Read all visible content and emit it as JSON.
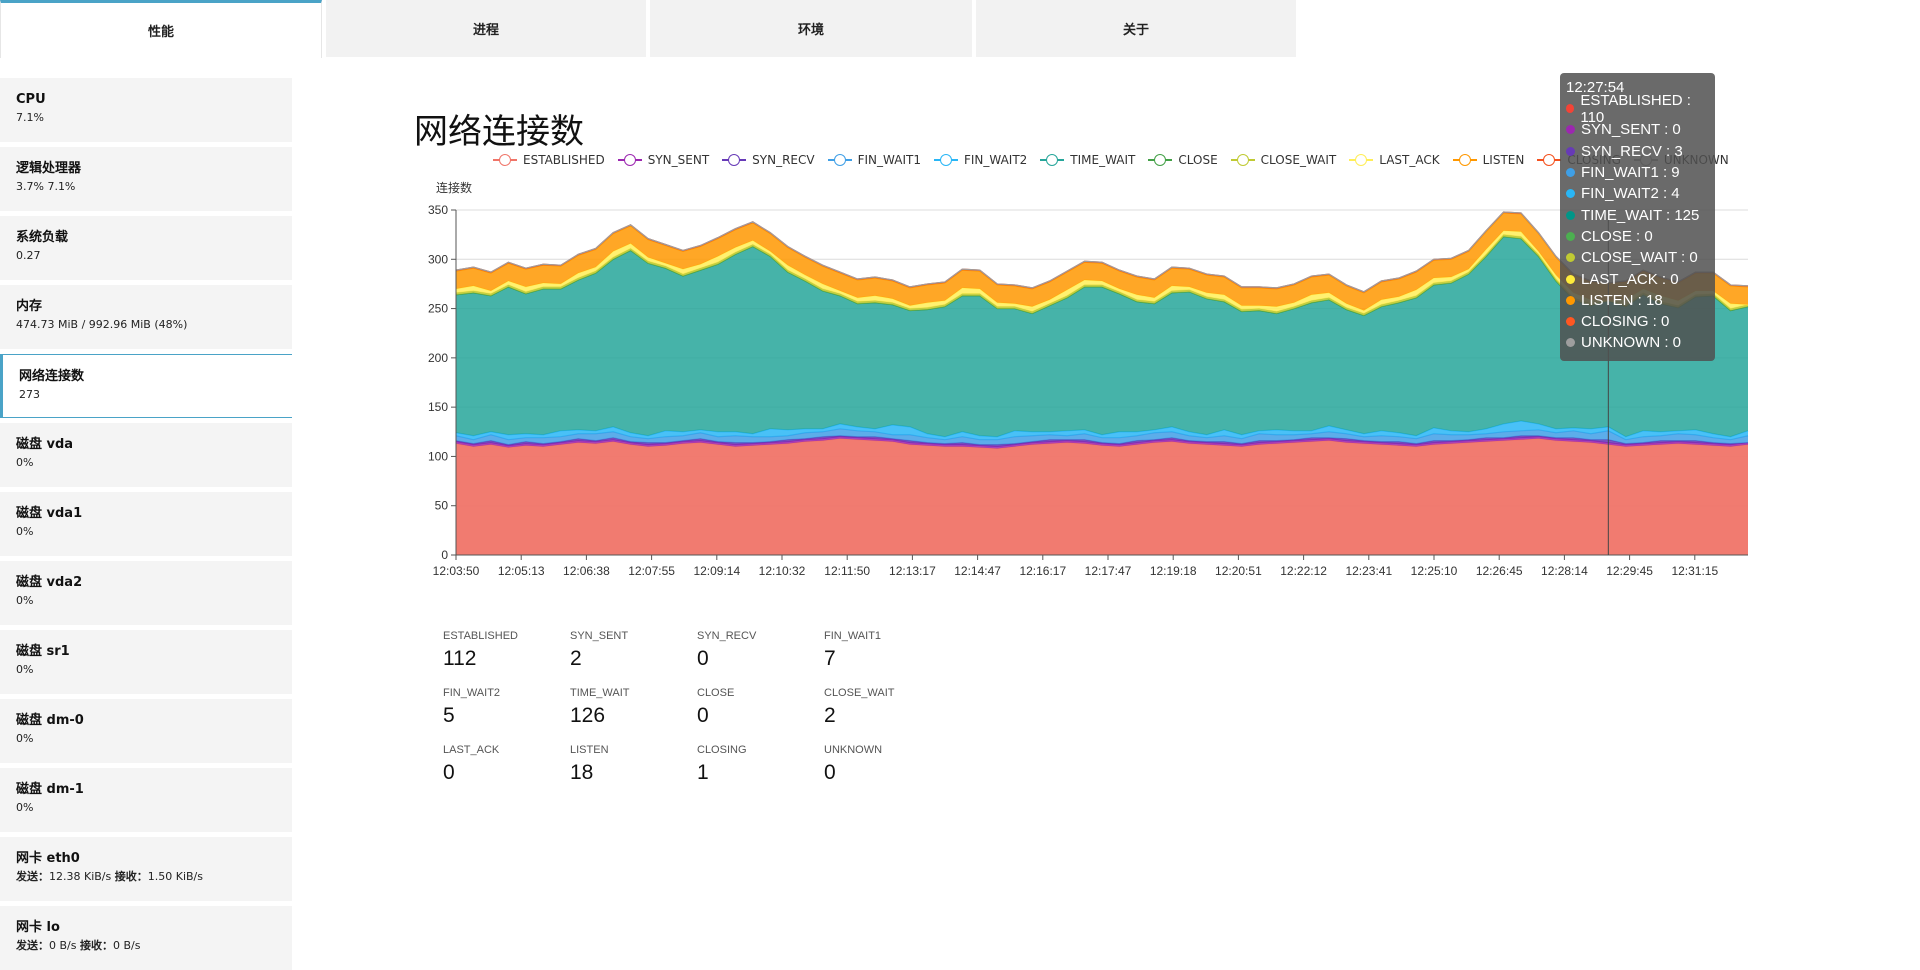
{
  "tabs": [
    {
      "label": "性能",
      "active": true
    },
    {
      "label": "进程",
      "active": false
    },
    {
      "label": "环境",
      "active": false
    },
    {
      "label": "关于",
      "active": false
    }
  ],
  "sidebar": {
    "items": [
      {
        "title": "CPU",
        "value": "7.1%"
      },
      {
        "title": "逻辑处理器",
        "value": "3.7% 7.1%"
      },
      {
        "title": "系统负载",
        "value": "0.27"
      },
      {
        "title": "内存",
        "value": "474.73 MiB / 992.96 MiB (48%)"
      },
      {
        "title": "网络连接数",
        "value": "273",
        "active": true
      },
      {
        "title": "磁盘 vda",
        "value": "0%"
      },
      {
        "title": "磁盘 vda1",
        "value": "0%"
      },
      {
        "title": "磁盘 vda2",
        "value": "0%"
      },
      {
        "title": "磁盘 sr1",
        "value": "0%"
      },
      {
        "title": "磁盘 dm-0",
        "value": "0%"
      },
      {
        "title": "磁盘 dm-1",
        "value": "0%"
      },
      {
        "title": "网卡 eth0",
        "send_label": "发送：",
        "send": "12.38 KiB/s",
        "recv_label": "接收：",
        "recv": "1.50 KiB/s"
      },
      {
        "title": "网卡 lo",
        "send_label": "发送：",
        "send": "0 B/s",
        "recv_label": "接收：",
        "recv": "0 B/s"
      }
    ]
  },
  "main": {
    "title": "网络连接数"
  },
  "chart_data": {
    "type": "area",
    "stacked": true,
    "ylabel": "连接数",
    "ylim": [
      0,
      350
    ],
    "yticks": [
      0,
      50,
      100,
      150,
      200,
      250,
      300,
      350
    ],
    "x_ticks": [
      "12:03:50",
      "12:05:13",
      "12:06:38",
      "12:07:55",
      "12:09:14",
      "12:10:32",
      "12:11:50",
      "12:13:17",
      "12:14:47",
      "12:16:17",
      "12:17:47",
      "12:19:18",
      "12:20:51",
      "12:22:12",
      "12:23:41",
      "12:25:10",
      "12:26:45",
      "12:28:14",
      "12:29:45",
      "12:31:15"
    ],
    "legend_position": "top",
    "series": [
      {
        "name": "ESTABLISHED",
        "color": "#f07468",
        "values": [
          113,
          110,
          112,
          109,
          111,
          110,
          112,
          114,
          113,
          115,
          112,
          110,
          111,
          113,
          114,
          112,
          110,
          111,
          112,
          113,
          115,
          116,
          118,
          117,
          116,
          115,
          112,
          111,
          110,
          110,
          109,
          108,
          110,
          112,
          113,
          114,
          113,
          111,
          110,
          112,
          114,
          115,
          113,
          112,
          111,
          110,
          112,
          113,
          114,
          115,
          116,
          114,
          113,
          112,
          111,
          110,
          112,
          113,
          114,
          115,
          116,
          117,
          118,
          116,
          115,
          114,
          112,
          110,
          111,
          112,
          113,
          112,
          111,
          110,
          112
        ]
      },
      {
        "name": "SYN_SENT",
        "color": "#9c27b0",
        "values": [
          2,
          2,
          2,
          2,
          2,
          2,
          2,
          2,
          2,
          2,
          2,
          2,
          2,
          2,
          2,
          2,
          2,
          2,
          2,
          2,
          2,
          2,
          2,
          2,
          2,
          2,
          2,
          2,
          2,
          2,
          2,
          2,
          2,
          2,
          2,
          2,
          2,
          2,
          2,
          2,
          2,
          2,
          2,
          2,
          2,
          2,
          2,
          2,
          2,
          2,
          2,
          2,
          2,
          2,
          2,
          2,
          2,
          2,
          2,
          2,
          2,
          2,
          2,
          2,
          2,
          2,
          2,
          2,
          2,
          2,
          2,
          2,
          2,
          2,
          2
        ]
      },
      {
        "name": "SYN_RECV",
        "color": "#673ab7",
        "values": [
          1,
          1,
          2,
          1,
          2,
          1,
          1,
          2,
          1,
          2,
          1,
          2,
          1,
          1,
          2,
          1,
          2,
          1,
          1,
          2,
          1,
          2,
          1,
          1,
          2,
          1,
          2,
          1,
          1,
          2,
          1,
          2,
          1,
          1,
          2,
          1,
          2,
          1,
          1,
          2,
          1,
          2,
          1,
          1,
          2,
          1,
          2,
          1,
          1,
          2,
          1,
          2,
          1,
          1,
          2,
          1,
          2,
          1,
          1,
          2,
          1,
          2,
          1,
          1,
          2,
          1,
          3,
          1,
          1,
          2,
          1,
          2,
          1,
          1,
          0
        ]
      },
      {
        "name": "FIN_WAIT1",
        "color": "#3f9fe6",
        "values": [
          5,
          4,
          6,
          5,
          4,
          6,
          5,
          5,
          7,
          6,
          5,
          4,
          6,
          5,
          6,
          5,
          7,
          6,
          5,
          4,
          6,
          5,
          7,
          6,
          5,
          4,
          6,
          5,
          4,
          6,
          5,
          5,
          7,
          6,
          5,
          4,
          6,
          5,
          6,
          5,
          7,
          6,
          5,
          4,
          6,
          5,
          7,
          6,
          5,
          4,
          6,
          5,
          4,
          6,
          5,
          5,
          7,
          6,
          5,
          4,
          6,
          5,
          6,
          5,
          7,
          6,
          9,
          4,
          6,
          5,
          7,
          6,
          5,
          4,
          7
        ]
      },
      {
        "name": "FIN_WAIT2",
        "color": "#29b6f6",
        "values": [
          3,
          4,
          3,
          5,
          4,
          3,
          6,
          4,
          3,
          5,
          4,
          3,
          6,
          4,
          3,
          5,
          4,
          3,
          8,
          6,
          4,
          3,
          5,
          4,
          3,
          10,
          8,
          4,
          3,
          5,
          4,
          3,
          6,
          4,
          3,
          5,
          4,
          3,
          6,
          4,
          3,
          5,
          4,
          3,
          6,
          4,
          3,
          5,
          4,
          3,
          6,
          4,
          3,
          5,
          4,
          3,
          6,
          4,
          3,
          5,
          8,
          10,
          6,
          4,
          3,
          5,
          4,
          3,
          6,
          4,
          3,
          5,
          4,
          3,
          5
        ]
      },
      {
        "name": "TIME_WAIT",
        "color": "#26a69a",
        "values": [
          140,
          145,
          138,
          150,
          142,
          148,
          144,
          152,
          160,
          170,
          185,
          175,
          165,
          158,
          162,
          170,
          180,
          190,
          175,
          160,
          150,
          140,
          130,
          125,
          128,
          122,
          118,
          126,
          132,
          138,
          142,
          130,
          124,
          120,
          128,
          135,
          145,
          150,
          140,
          132,
          128,
          136,
          142,
          138,
          130,
          125,
          122,
          118,
          124,
          130,
          128,
          122,
          120,
          126,
          132,
          140,
          145,
          150,
          160,
          175,
          190,
          185,
          170,
          150,
          130,
          125,
          128,
          132,
          138,
          130,
          125,
          135,
          140,
          128,
          126
        ]
      },
      {
        "name": "CLOSE",
        "color": "#43a047",
        "values": [
          0,
          0,
          0,
          0,
          0,
          0,
          0,
          0,
          0,
          0,
          0,
          0,
          0,
          0,
          0,
          0,
          0,
          0,
          0,
          0,
          0,
          0,
          0,
          0,
          0,
          0,
          0,
          0,
          0,
          0,
          0,
          0,
          0,
          0,
          0,
          0,
          0,
          0,
          0,
          0,
          0,
          0,
          0,
          0,
          0,
          0,
          0,
          0,
          0,
          0,
          0,
          0,
          0,
          0,
          0,
          0,
          0,
          0,
          0,
          0,
          0,
          0,
          0,
          0,
          0,
          0,
          0,
          0,
          0,
          0,
          0,
          0,
          0,
          0,
          0
        ]
      },
      {
        "name": "CLOSE_WAIT",
        "color": "#c0ca33",
        "values": [
          2,
          2,
          2,
          2,
          2,
          2,
          2,
          2,
          2,
          2,
          2,
          2,
          2,
          2,
          2,
          2,
          2,
          2,
          2,
          2,
          2,
          2,
          2,
          2,
          2,
          2,
          2,
          2,
          2,
          2,
          2,
          2,
          2,
          2,
          2,
          2,
          2,
          2,
          2,
          2,
          2,
          2,
          2,
          2,
          2,
          2,
          2,
          2,
          2,
          2,
          2,
          2,
          2,
          2,
          2,
          2,
          2,
          2,
          2,
          2,
          2,
          2,
          2,
          2,
          2,
          2,
          0,
          2,
          2,
          2,
          2,
          2,
          2,
          2,
          2
        ]
      },
      {
        "name": "LAST_ACK",
        "color": "#ffee58",
        "values": [
          4,
          5,
          3,
          4,
          5,
          4,
          3,
          5,
          4,
          6,
          5,
          4,
          3,
          5,
          4,
          6,
          5,
          4,
          3,
          5,
          4,
          5,
          3,
          4,
          5,
          4,
          3,
          5,
          4,
          6,
          5,
          4,
          3,
          5,
          4,
          6,
          5,
          4,
          3,
          5,
          4,
          5,
          3,
          4,
          5,
          4,
          3,
          5,
          4,
          6,
          5,
          4,
          3,
          5,
          4,
          6,
          5,
          4,
          3,
          5,
          4,
          5,
          3,
          4,
          5,
          4,
          0,
          5,
          4,
          6,
          5,
          4,
          3,
          5,
          0
        ]
      },
      {
        "name": "LISTEN",
        "color": "#ff9800",
        "values": [
          18,
          18,
          18,
          18,
          18,
          18,
          18,
          18,
          18,
          18,
          18,
          18,
          18,
          18,
          18,
          18,
          18,
          18,
          18,
          18,
          18,
          18,
          18,
          18,
          18,
          18,
          18,
          18,
          18,
          18,
          18,
          18,
          18,
          18,
          18,
          18,
          18,
          18,
          18,
          18,
          18,
          18,
          18,
          18,
          18,
          18,
          18,
          18,
          18,
          18,
          18,
          18,
          18,
          18,
          18,
          18,
          18,
          18,
          18,
          18,
          18,
          18,
          18,
          18,
          18,
          18,
          18,
          18,
          18,
          18,
          18,
          18,
          18,
          18,
          18
        ]
      },
      {
        "name": "CLOSING",
        "color": "#f4511e",
        "values": [
          1,
          1,
          1,
          1,
          1,
          1,
          1,
          1,
          1,
          1,
          1,
          1,
          1,
          1,
          1,
          1,
          1,
          1,
          1,
          1,
          1,
          1,
          1,
          1,
          1,
          1,
          1,
          1,
          1,
          1,
          1,
          1,
          1,
          1,
          1,
          1,
          1,
          1,
          1,
          1,
          1,
          1,
          1,
          1,
          1,
          1,
          1,
          1,
          1,
          1,
          1,
          1,
          1,
          1,
          1,
          1,
          1,
          1,
          1,
          1,
          1,
          1,
          1,
          1,
          1,
          1,
          0,
          1,
          1,
          1,
          1,
          1,
          1,
          1,
          1
        ]
      },
      {
        "name": "UNKNOWN",
        "color": "#9e9e9e",
        "values": [
          0,
          0,
          0,
          0,
          0,
          0,
          0,
          0,
          0,
          0,
          0,
          0,
          0,
          0,
          0,
          0,
          0,
          0,
          0,
          0,
          0,
          0,
          0,
          0,
          0,
          0,
          0,
          0,
          0,
          0,
          0,
          0,
          0,
          0,
          0,
          0,
          0,
          0,
          0,
          0,
          0,
          0,
          0,
          0,
          0,
          0,
          0,
          0,
          0,
          0,
          0,
          0,
          0,
          0,
          0,
          0,
          0,
          0,
          0,
          0,
          0,
          0,
          0,
          0,
          0,
          0,
          0,
          0,
          0,
          0,
          0,
          0,
          0,
          0,
          0
        ]
      }
    ]
  },
  "tooltip": {
    "time": "12:27:54",
    "rows": [
      {
        "label": "ESTABLISHED : 110",
        "color": "#f44336"
      },
      {
        "label": "SYN_SENT : 0",
        "color": "#9c27b0"
      },
      {
        "label": "SYN_RECV : 3",
        "color": "#673ab7"
      },
      {
        "label": "FIN_WAIT1 : 9",
        "color": "#3f9fe6"
      },
      {
        "label": "FIN_WAIT2 : 4",
        "color": "#29b6f6"
      },
      {
        "label": "TIME_WAIT : 125",
        "color": "#009688"
      },
      {
        "label": "CLOSE : 0",
        "color": "#4caf50"
      },
      {
        "label": "CLOSE_WAIT : 0",
        "color": "#c0ca33"
      },
      {
        "label": "LAST_ACK : 0",
        "color": "#ffeb3b"
      },
      {
        "label": "LISTEN : 18",
        "color": "#ff9800"
      },
      {
        "label": "CLOSING : 0",
        "color": "#ff5722"
      },
      {
        "label": "UNKNOWN : 0",
        "color": "#9e9e9e"
      }
    ]
  },
  "stats": [
    {
      "label": "ESTABLISHED",
      "value": "112"
    },
    {
      "label": "SYN_SENT",
      "value": "2"
    },
    {
      "label": "SYN_RECV",
      "value": "0"
    },
    {
      "label": "FIN_WAIT1",
      "value": "7"
    },
    {
      "label": "FIN_WAIT2",
      "value": "5"
    },
    {
      "label": "TIME_WAIT",
      "value": "126"
    },
    {
      "label": "CLOSE",
      "value": "0"
    },
    {
      "label": "CLOSE_WAIT",
      "value": "2"
    },
    {
      "label": "LAST_ACK",
      "value": "0"
    },
    {
      "label": "LISTEN",
      "value": "18"
    },
    {
      "label": "CLOSING",
      "value": "1"
    },
    {
      "label": "UNKNOWN",
      "value": "0"
    }
  ]
}
